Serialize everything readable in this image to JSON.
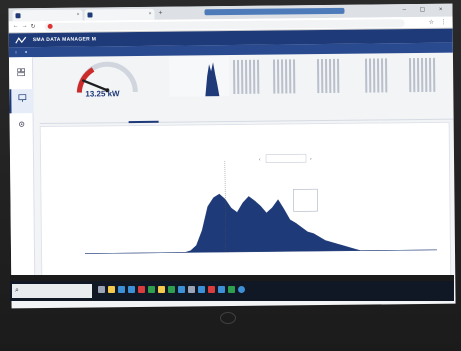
{
  "browser": {
    "tabs": [
      {
        "label": ""
      },
      {
        "label": ""
      }
    ],
    "url": ""
  },
  "app": {
    "title": "SMA DATA MANAGER M",
    "subnav": [
      "",
      ""
    ]
  },
  "sidebar": {
    "items": [
      {
        "label": "",
        "icon": "dashboard-icon"
      },
      {
        "label": "",
        "icon": "monitor-icon"
      },
      {
        "label": "",
        "icon": "gear-icon"
      }
    ]
  },
  "power": {
    "value": "13.25 kW",
    "subtitle": ""
  },
  "chart_tabs": [
    "",
    "",
    "",
    "",
    "",
    ""
  ],
  "chart_data": {
    "type": "area",
    "title": "",
    "xlabel": "",
    "ylabel": "",
    "color": "#1e3a78",
    "ylim": [
      0,
      1
    ],
    "yticks": [],
    "x_tick_labels": [],
    "date_label": "",
    "tooltip": {
      "time": "",
      "label": "",
      "value": ""
    },
    "x": [
      0,
      1,
      2,
      3,
      4,
      5,
      6,
      7,
      8,
      9,
      10,
      11,
      12,
      13,
      14,
      15,
      16,
      17,
      18,
      19,
      20,
      21,
      22,
      23,
      24,
      25,
      26,
      27,
      28,
      29,
      30,
      31,
      32,
      33,
      34,
      35,
      36,
      37,
      38,
      39,
      40,
      41,
      42,
      43,
      44,
      45,
      46,
      47,
      48,
      49,
      50,
      51,
      52,
      53,
      54,
      55,
      56,
      57,
      58,
      59,
      60
    ],
    "values": [
      0,
      0,
      0,
      0,
      0,
      0,
      0,
      0,
      0,
      0,
      0,
      0,
      0,
      0,
      0,
      0,
      0,
      0,
      0.02,
      0.08,
      0.25,
      0.52,
      0.62,
      0.66,
      0.6,
      0.5,
      0.45,
      0.56,
      0.63,
      0.58,
      0.52,
      0.44,
      0.5,
      0.59,
      0.48,
      0.36,
      0.32,
      0.27,
      0.22,
      0.2,
      0.16,
      0.12,
      0.1,
      0.08,
      0.06,
      0.04,
      0.02,
      0,
      0,
      0,
      0,
      0,
      0,
      0,
      0,
      0,
      0,
      0,
      0,
      0,
      0
    ]
  },
  "taskbar": {
    "search_placeholder": "",
    "clock": ""
  },
  "colors": {
    "brand": "#1e3a78",
    "chart_fill": "#1e3a78"
  }
}
